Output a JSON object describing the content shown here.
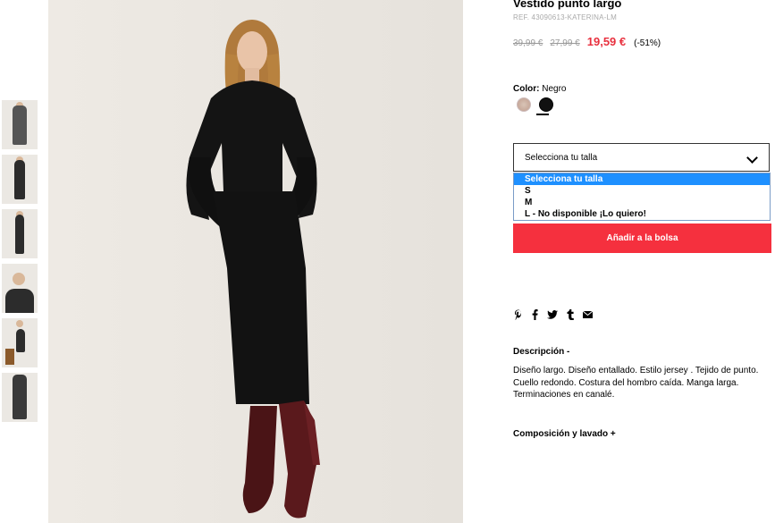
{
  "product": {
    "title": "Vestido punto largo",
    "ref": "REF. 43090613-KATERINA-LM",
    "price_original": "39,99 €",
    "price_previous": "27,99 €",
    "price_current": "19,59 €",
    "discount": "(-51%)"
  },
  "color": {
    "label": "Color:",
    "selected": "Negro",
    "swatches": [
      "beige-swatch",
      "black-swatch"
    ]
  },
  "size": {
    "placeholder": "Selecciona tu talla",
    "options": [
      "Selecciona tu talla",
      "S",
      "M",
      "L - No disponible ¡Lo quiero!"
    ]
  },
  "add_to_bag": "Añadir a la bolsa",
  "share_icons": [
    "pinterest-icon",
    "facebook-icon",
    "twitter-icon",
    "tumblr-icon",
    "email-icon"
  ],
  "description": {
    "heading": "Descripción  -",
    "text": "Diseño largo. Diseño entallado. Estilo jersey . Tejido de punto. Cuello redondo. Costura del hombro caída. Manga larga. Terminaciones en canalé."
  },
  "composition": {
    "heading": "Composición y lavado  +"
  },
  "colors": {
    "sale_red": "#e8303e",
    "button_red": "#f5303e",
    "option_highlight": "#1e90ff"
  }
}
